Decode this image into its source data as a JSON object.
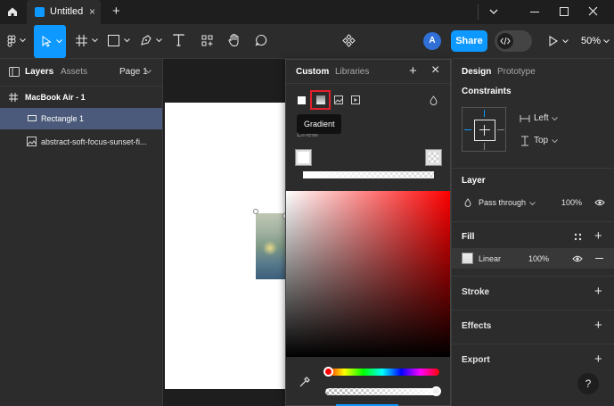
{
  "titlebar": {
    "home_icon": "home-icon",
    "tab_title": "Untitled",
    "new_tab_symbol": "+",
    "window_controls": [
      "chevron-down-icon",
      "minimize-icon",
      "maximize-icon",
      "close-icon"
    ]
  },
  "toolbar": {
    "tools": [
      "main-menu-icon",
      "move-tool-icon",
      "frame-tool-icon",
      "shape-tool-icon",
      "pen-tool-icon",
      "text-tool-icon",
      "resources-icon",
      "hand-tool-icon",
      "comment-tool-icon"
    ],
    "components_icon": "components-icon",
    "avatar_letter": "A",
    "share_label": "Share",
    "dev_mode_icon": "code-icon",
    "play_icon": "play-icon",
    "zoom": "50%"
  },
  "left_panel": {
    "tab_layers": "Layers",
    "tab_assets": "Assets",
    "page_label": "Page 1",
    "layers": [
      {
        "name": "MacBook Air - 1",
        "icon": "frame-icon"
      },
      {
        "name": "Rectangle 1",
        "icon": "rectangle-icon"
      },
      {
        "name": "abstract-soft-focus-sunset-fi...",
        "icon": "image-icon"
      }
    ]
  },
  "fill_popup": {
    "tab_custom": "Custom",
    "tab_libraries": "Libraries",
    "add_symbol": "+",
    "close_symbol": "×",
    "fill_types": [
      "solid-fill-icon",
      "gradient-fill-icon",
      "image-fill-icon",
      "video-fill-icon"
    ],
    "blend_icon": "blend-drop-icon",
    "tooltip": "Gradient",
    "section_label": "Linear",
    "eyedropper_icon": "eyedropper-icon",
    "highlight_color": "#e5202a"
  },
  "right_panel": {
    "tab_design": "Design",
    "tab_prototype": "Prototype",
    "constraints_label": "Constraints",
    "horizontal_constraint": "Left",
    "vertical_constraint": "Top",
    "layer_label": "Layer",
    "blend_mode": "Pass through",
    "layer_opacity": "100%",
    "fill_label": "Fill",
    "fill_type": "Linear",
    "fill_opacity": "100%",
    "stroke_label": "Stroke",
    "effects_label": "Effects",
    "export_label": "Export",
    "help_symbol": "?"
  },
  "colors": {
    "accent": "#0d99ff",
    "selection": "#4b5a7a",
    "panel": "#2c2c2c",
    "titlebar": "#1e1e1e"
  }
}
